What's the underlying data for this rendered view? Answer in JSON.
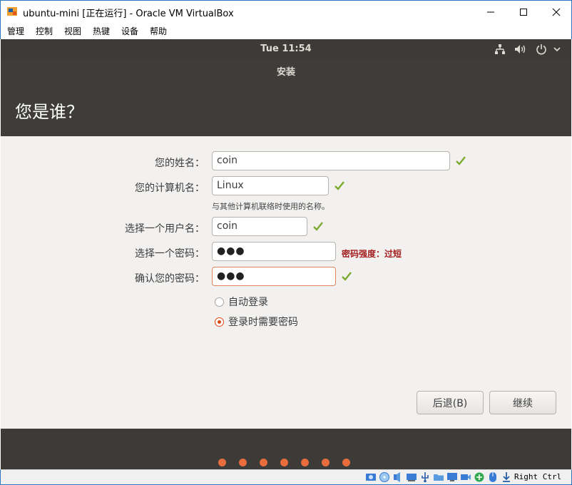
{
  "window": {
    "title": "ubuntu-mini [正在运行] - Oracle VM VirtualBox",
    "minimize_glyph": "—",
    "maximize_glyph": "☐",
    "close_glyph": "✕"
  },
  "menubar": {
    "items": [
      "管理",
      "控制",
      "视图",
      "热键",
      "设备",
      "帮助"
    ]
  },
  "guest": {
    "clock": "Tue 11:54",
    "tray_icons": [
      "network-icon",
      "volume-icon",
      "power-icon",
      "chevron-down-icon"
    ]
  },
  "installer": {
    "dialog_title": "安装",
    "heading": "您是谁？",
    "name_label": "您的姓名：",
    "name_value": "coin",
    "computer_label": "您的计算机名：",
    "computer_value": "Linux",
    "computer_hint": "与其他计算机联络时使用的名称。",
    "username_label": "选择一个用户名：",
    "username_value": "coin",
    "password_label": "选择一个密码：",
    "password_value": "●●●",
    "password_strength": "密码强度：过短",
    "confirm_label": "确认您的密码：",
    "confirm_value": "●●●",
    "auto_login_label": "自动登录",
    "require_password_label": "登录时需要密码",
    "selected_login_option": "登录时需要密码",
    "back_button": "后退(B)",
    "continue_button": "继续",
    "progress_steps_total": 7
  },
  "statusbar": {
    "host_key": "Right Ctrl"
  },
  "colors": {
    "accent_orange": "#dd4814",
    "check_green": "#7caa2c",
    "error_red": "#a21d1d",
    "panel_dark": "#3c3b37"
  }
}
